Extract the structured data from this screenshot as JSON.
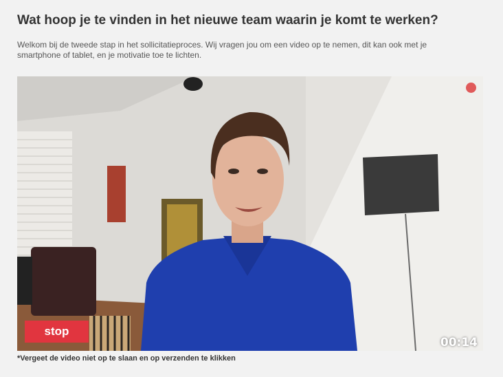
{
  "page": {
    "title": "Wat hoop je te vinden in het nieuwe team waarin je komt te werken?",
    "intro": "Welkom bij de tweede stap in het sollicitatieproces. Wij vragen jou om een video op te nemen, dit kan ook met je smartphone of tablet, en je motivatie toe te lichten.",
    "note": "*Vergeet de video niet op te slaan en op verzenden te klikken"
  },
  "recorder": {
    "recording_indicator": "record-dot-icon",
    "recording_color": "#e05a5a",
    "stop_label": "stop",
    "stop_color": "#e1353f",
    "elapsed": "00:14"
  }
}
